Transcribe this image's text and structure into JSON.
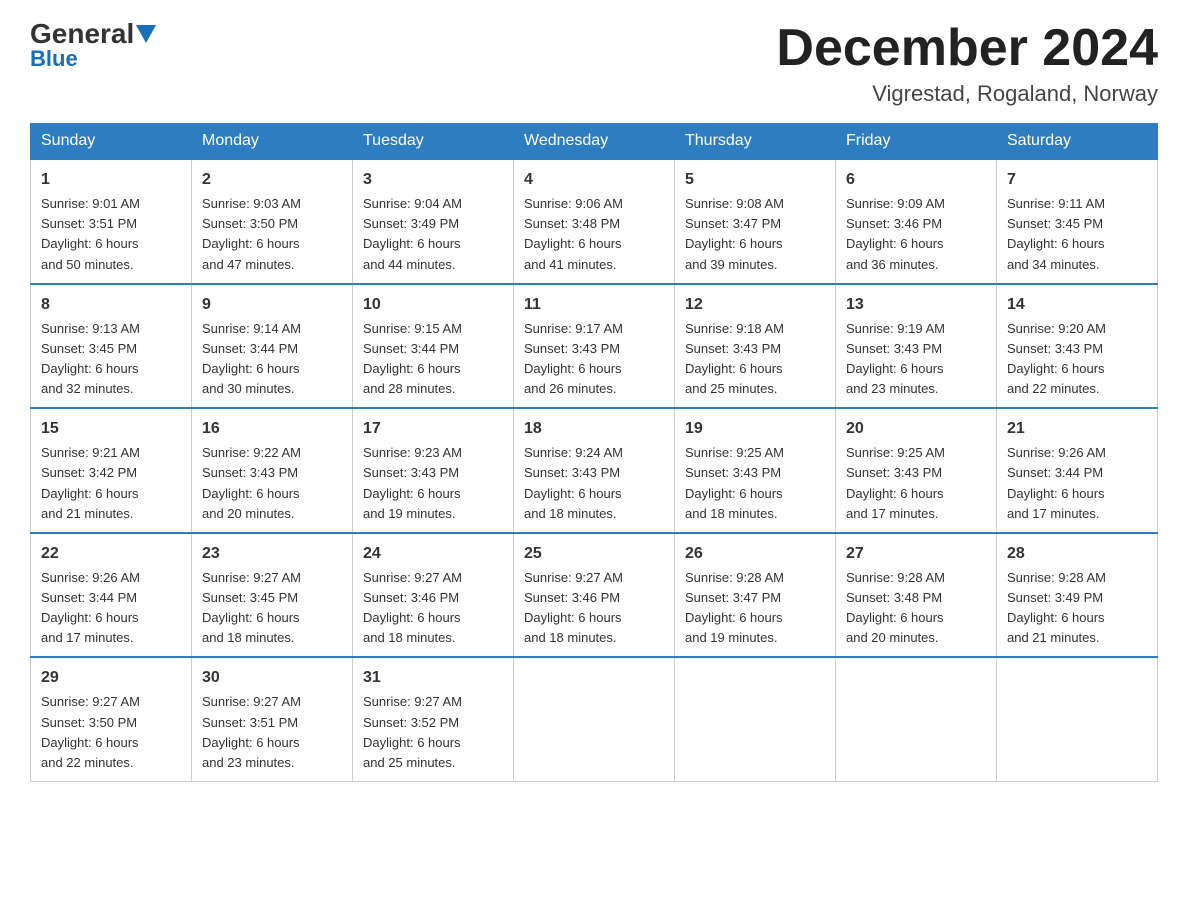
{
  "header": {
    "logo_general": "General",
    "logo_blue": "Blue",
    "month_title": "December 2024",
    "location": "Vigrestad, Rogaland, Norway"
  },
  "days_of_week": [
    "Sunday",
    "Monday",
    "Tuesday",
    "Wednesday",
    "Thursday",
    "Friday",
    "Saturday"
  ],
  "weeks": [
    [
      {
        "num": "1",
        "sunrise": "9:01 AM",
        "sunset": "3:51 PM",
        "daylight": "6 hours and 50 minutes."
      },
      {
        "num": "2",
        "sunrise": "9:03 AM",
        "sunset": "3:50 PM",
        "daylight": "6 hours and 47 minutes."
      },
      {
        "num": "3",
        "sunrise": "9:04 AM",
        "sunset": "3:49 PM",
        "daylight": "6 hours and 44 minutes."
      },
      {
        "num": "4",
        "sunrise": "9:06 AM",
        "sunset": "3:48 PM",
        "daylight": "6 hours and 41 minutes."
      },
      {
        "num": "5",
        "sunrise": "9:08 AM",
        "sunset": "3:47 PM",
        "daylight": "6 hours and 39 minutes."
      },
      {
        "num": "6",
        "sunrise": "9:09 AM",
        "sunset": "3:46 PM",
        "daylight": "6 hours and 36 minutes."
      },
      {
        "num": "7",
        "sunrise": "9:11 AM",
        "sunset": "3:45 PM",
        "daylight": "6 hours and 34 minutes."
      }
    ],
    [
      {
        "num": "8",
        "sunrise": "9:13 AM",
        "sunset": "3:45 PM",
        "daylight": "6 hours and 32 minutes."
      },
      {
        "num": "9",
        "sunrise": "9:14 AM",
        "sunset": "3:44 PM",
        "daylight": "6 hours and 30 minutes."
      },
      {
        "num": "10",
        "sunrise": "9:15 AM",
        "sunset": "3:44 PM",
        "daylight": "6 hours and 28 minutes."
      },
      {
        "num": "11",
        "sunrise": "9:17 AM",
        "sunset": "3:43 PM",
        "daylight": "6 hours and 26 minutes."
      },
      {
        "num": "12",
        "sunrise": "9:18 AM",
        "sunset": "3:43 PM",
        "daylight": "6 hours and 25 minutes."
      },
      {
        "num": "13",
        "sunrise": "9:19 AM",
        "sunset": "3:43 PM",
        "daylight": "6 hours and 23 minutes."
      },
      {
        "num": "14",
        "sunrise": "9:20 AM",
        "sunset": "3:43 PM",
        "daylight": "6 hours and 22 minutes."
      }
    ],
    [
      {
        "num": "15",
        "sunrise": "9:21 AM",
        "sunset": "3:42 PM",
        "daylight": "6 hours and 21 minutes."
      },
      {
        "num": "16",
        "sunrise": "9:22 AM",
        "sunset": "3:43 PM",
        "daylight": "6 hours and 20 minutes."
      },
      {
        "num": "17",
        "sunrise": "9:23 AM",
        "sunset": "3:43 PM",
        "daylight": "6 hours and 19 minutes."
      },
      {
        "num": "18",
        "sunrise": "9:24 AM",
        "sunset": "3:43 PM",
        "daylight": "6 hours and 18 minutes."
      },
      {
        "num": "19",
        "sunrise": "9:25 AM",
        "sunset": "3:43 PM",
        "daylight": "6 hours and 18 minutes."
      },
      {
        "num": "20",
        "sunrise": "9:25 AM",
        "sunset": "3:43 PM",
        "daylight": "6 hours and 17 minutes."
      },
      {
        "num": "21",
        "sunrise": "9:26 AM",
        "sunset": "3:44 PM",
        "daylight": "6 hours and 17 minutes."
      }
    ],
    [
      {
        "num": "22",
        "sunrise": "9:26 AM",
        "sunset": "3:44 PM",
        "daylight": "6 hours and 17 minutes."
      },
      {
        "num": "23",
        "sunrise": "9:27 AM",
        "sunset": "3:45 PM",
        "daylight": "6 hours and 18 minutes."
      },
      {
        "num": "24",
        "sunrise": "9:27 AM",
        "sunset": "3:46 PM",
        "daylight": "6 hours and 18 minutes."
      },
      {
        "num": "25",
        "sunrise": "9:27 AM",
        "sunset": "3:46 PM",
        "daylight": "6 hours and 18 minutes."
      },
      {
        "num": "26",
        "sunrise": "9:28 AM",
        "sunset": "3:47 PM",
        "daylight": "6 hours and 19 minutes."
      },
      {
        "num": "27",
        "sunrise": "9:28 AM",
        "sunset": "3:48 PM",
        "daylight": "6 hours and 20 minutes."
      },
      {
        "num": "28",
        "sunrise": "9:28 AM",
        "sunset": "3:49 PM",
        "daylight": "6 hours and 21 minutes."
      }
    ],
    [
      {
        "num": "29",
        "sunrise": "9:27 AM",
        "sunset": "3:50 PM",
        "daylight": "6 hours and 22 minutes."
      },
      {
        "num": "30",
        "sunrise": "9:27 AM",
        "sunset": "3:51 PM",
        "daylight": "6 hours and 23 minutes."
      },
      {
        "num": "31",
        "sunrise": "9:27 AM",
        "sunset": "3:52 PM",
        "daylight": "6 hours and 25 minutes."
      },
      null,
      null,
      null,
      null
    ]
  ],
  "labels": {
    "sunrise_prefix": "Sunrise: ",
    "sunset_prefix": "Sunset: ",
    "daylight_prefix": "Daylight: "
  }
}
